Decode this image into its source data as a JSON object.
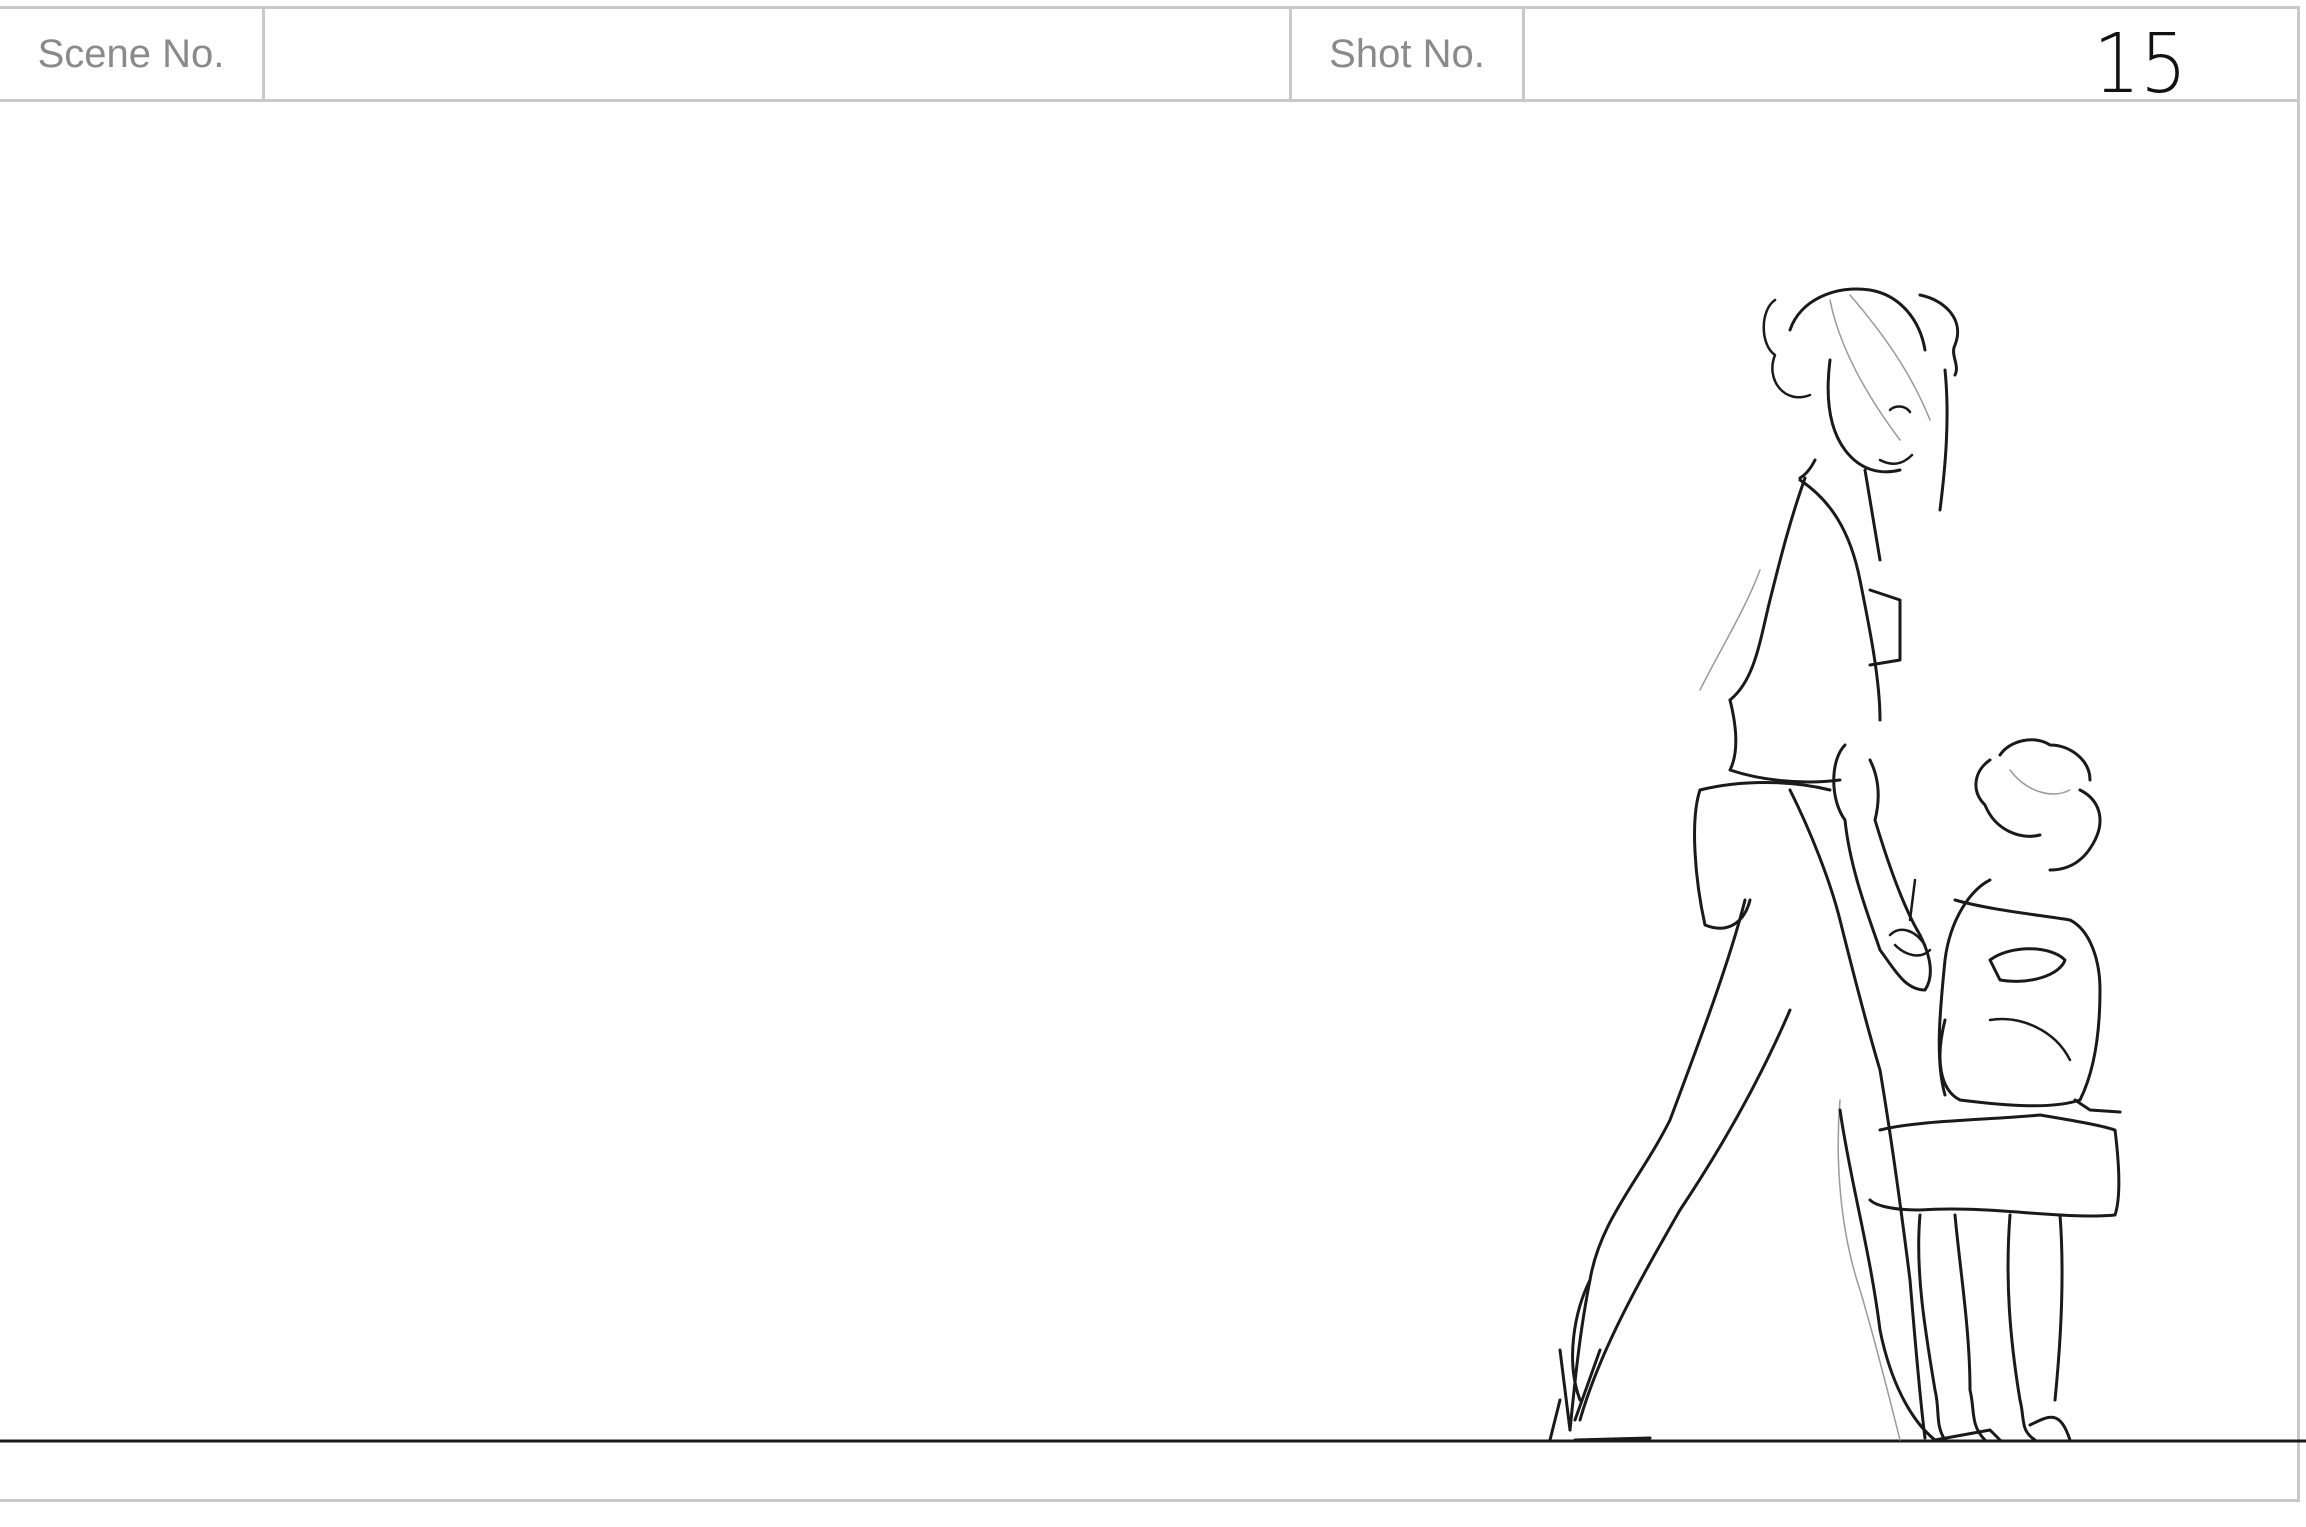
{
  "header": {
    "scene_label": "Scene No.",
    "scene_value": "",
    "shot_label": "Shot No.",
    "shot_value": "",
    "panel_number": "15"
  },
  "colors": {
    "frame_border": "#c9c9c9",
    "label_text": "#8a8a8a",
    "pencil": "#1a1a1a",
    "pencil_light": "#9a9a9a"
  }
}
